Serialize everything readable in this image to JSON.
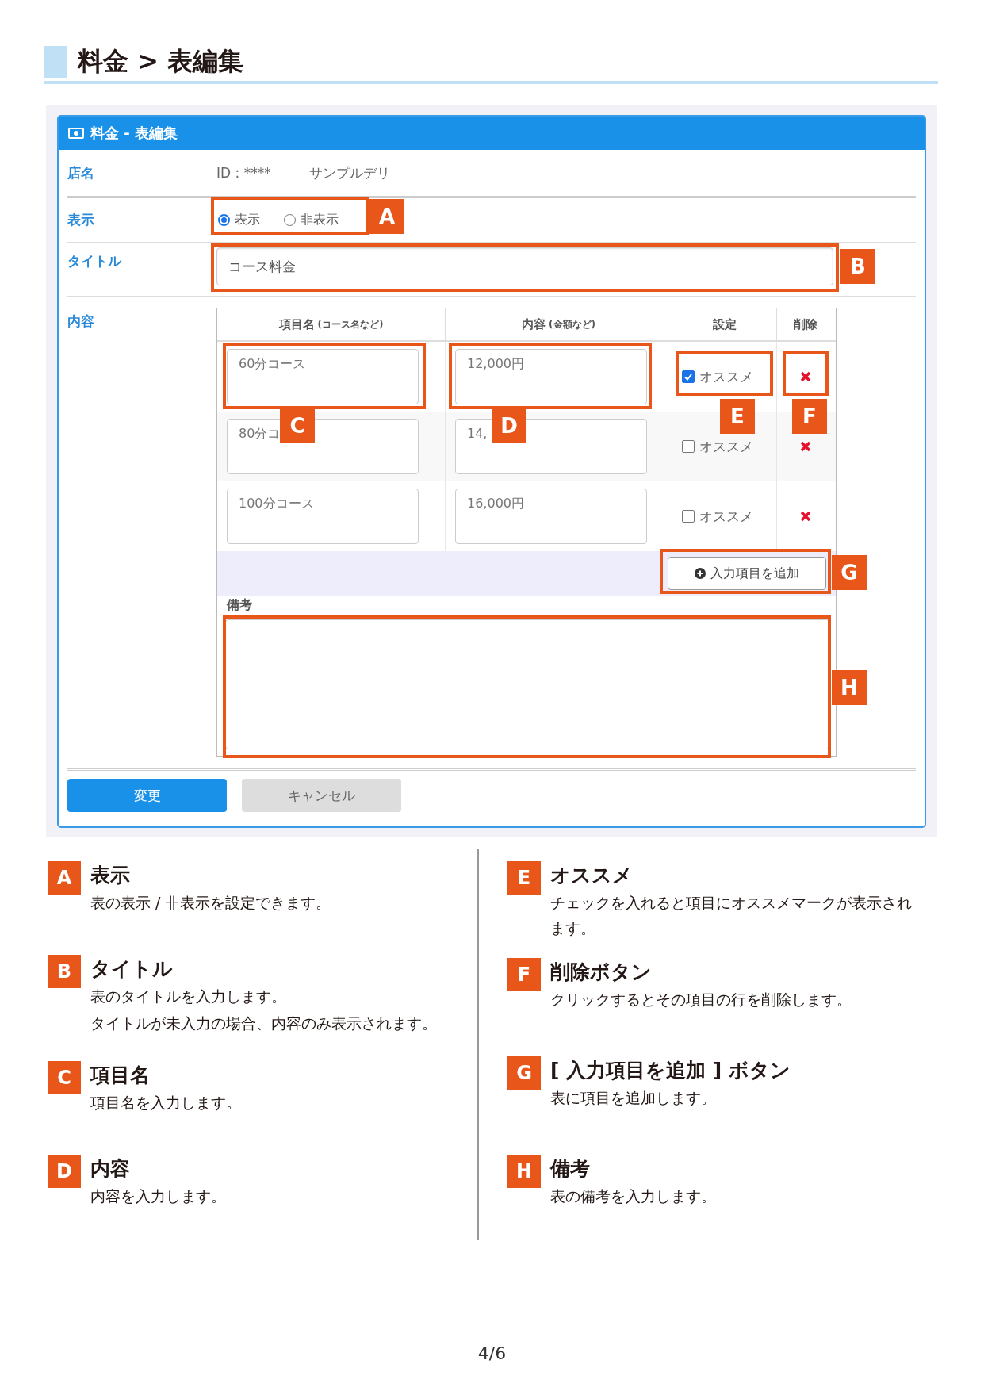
{
  "page_heading": "料金 > 表編集",
  "form": {
    "title": "料金 - 表編集",
    "shop": {
      "label": "店名",
      "id": "ID : ****",
      "name": "サンプルデリ"
    },
    "display": {
      "label": "表示",
      "options": [
        {
          "label": "表示",
          "selected": true
        },
        {
          "label": "非表示",
          "selected": false
        }
      ]
    },
    "title_field": {
      "label": "タイトル",
      "value": "コース料金"
    },
    "content": {
      "label": "内容",
      "columns": [
        {
          "label": "項目名",
          "note": "(コース名など)"
        },
        {
          "label": "内容",
          "note": "(金額など)"
        },
        {
          "label": "設定"
        },
        {
          "label": "削除"
        }
      ],
      "rows": [
        {
          "name": "60分コース",
          "value": "12,000円",
          "recommend": "オススメ",
          "checked": true
        },
        {
          "name": "80分コ",
          "value": "14,",
          "recommend": "オススメ",
          "checked": false
        },
        {
          "name": "100分コース",
          "value": "16,000円",
          "recommend": "オススメ",
          "checked": false
        }
      ],
      "add_button": "入力項目を追加",
      "notes_label": "備考"
    },
    "buttons": [
      {
        "label": "変更",
        "kind": "primary"
      },
      {
        "label": "キャンセル",
        "kind": "secondary"
      }
    ]
  },
  "callouts": [
    {
      "letter": "A"
    },
    {
      "letter": "B"
    },
    {
      "letter": "C"
    },
    {
      "letter": "D"
    },
    {
      "letter": "E"
    },
    {
      "letter": "F"
    },
    {
      "letter": "G"
    },
    {
      "letter": "H"
    }
  ],
  "legend": [
    {
      "letter": "A",
      "title": "表示",
      "description": [
        "表の表示 / 非表示を設定できます。"
      ]
    },
    {
      "letter": "B",
      "title": "タイトル",
      "description": [
        "表のタイトルを入力します。",
        "タイトルが未入力の場合、内容のみ表示されます。"
      ]
    },
    {
      "letter": "C",
      "title": "項目名",
      "description": [
        "項目名を入力します。"
      ]
    },
    {
      "letter": "D",
      "title": "内容",
      "description": [
        "内容を入力します。"
      ]
    },
    {
      "letter": "E",
      "title": "オススメ",
      "description": [
        "チェックを入れると項目にオススメマークが表示されます。"
      ]
    },
    {
      "letter": "F",
      "title": "削除ボタン",
      "description": [
        "クリックするとその項目の行を削除します。"
      ]
    },
    {
      "letter": "G",
      "title": "[ 入力項目を追加 ] ボタン",
      "description": [
        "表に項目を追加します。"
      ]
    },
    {
      "letter": "H",
      "title": "備考",
      "description": [
        "表の備考を入力します。"
      ]
    }
  ],
  "page_number": "4/6"
}
